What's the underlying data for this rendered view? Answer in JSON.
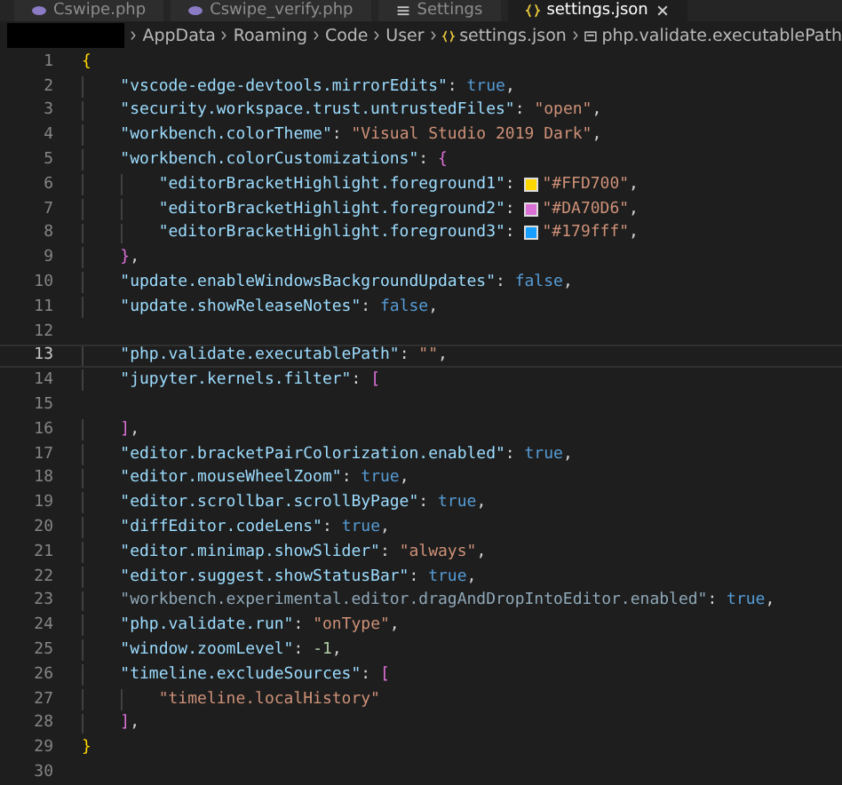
{
  "tabs": [
    {
      "label": "Cswipe.php",
      "kind": "php",
      "selected": false
    },
    {
      "label": "Cswipe_verify.php",
      "kind": "php",
      "selected": false
    },
    {
      "label": "Settings",
      "kind": "settings",
      "selected": false
    },
    {
      "label": "settings.json",
      "kind": "json",
      "selected": true
    }
  ],
  "breadcrumb": [
    {
      "label": "AppData",
      "kind": "folder"
    },
    {
      "label": "Roaming",
      "kind": "folder"
    },
    {
      "label": "Code",
      "kind": "folder"
    },
    {
      "label": "User",
      "kind": "folder"
    },
    {
      "label": "settings.json",
      "kind": "json"
    },
    {
      "label": "php.validate.executablePath",
      "kind": "property"
    }
  ],
  "lines": [
    {
      "number": "1",
      "active": false,
      "tokens": [
        {
          "kind": "bracket1",
          "text": "{"
        }
      ]
    },
    {
      "number": "2",
      "active": false,
      "tokens": [
        {
          "kind": "key",
          "text": "    \"vscode-edge-devtools.mirrorEdits\""
        },
        {
          "kind": "punct",
          "text": ": "
        },
        {
          "kind": "bool",
          "text": "true"
        },
        {
          "kind": "punct",
          "text": ","
        }
      ]
    },
    {
      "number": "3",
      "active": false,
      "tokens": [
        {
          "kind": "key",
          "text": "    \"security.workspace.trust.untrustedFiles\""
        },
        {
          "kind": "punct",
          "text": ": "
        },
        {
          "kind": "string",
          "text": "\"open\""
        },
        {
          "kind": "punct",
          "text": ","
        }
      ]
    },
    {
      "number": "4",
      "active": false,
      "tokens": [
        {
          "kind": "key",
          "text": "    \"workbench.colorTheme\""
        },
        {
          "kind": "punct",
          "text": ": "
        },
        {
          "kind": "string",
          "text": "\"Visual Studio 2019 Dark\""
        },
        {
          "kind": "punct",
          "text": ","
        }
      ]
    },
    {
      "number": "5",
      "active": false,
      "tokens": [
        {
          "kind": "key",
          "text": "    \"workbench.colorCustomizations\""
        },
        {
          "kind": "punct",
          "text": ": "
        },
        {
          "kind": "bracket2",
          "text": "{"
        }
      ]
    },
    {
      "number": "6",
      "active": false,
      "tokens": [
        {
          "kind": "key",
          "text": "        \"editorBracketHighlight.foreground1\""
        },
        {
          "kind": "punct",
          "text": ": "
        },
        {
          "kind": "swatch",
          "color": "#ffd700"
        },
        {
          "kind": "string",
          "text": "\"#FFD700\""
        },
        {
          "kind": "punct",
          "text": ","
        }
      ]
    },
    {
      "number": "7",
      "active": false,
      "tokens": [
        {
          "kind": "key",
          "text": "        \"editorBracketHighlight.foreground2\""
        },
        {
          "kind": "punct",
          "text": ": "
        },
        {
          "kind": "swatch",
          "color": "#da70d6"
        },
        {
          "kind": "string",
          "text": "\"#DA70D6\""
        },
        {
          "kind": "punct",
          "text": ","
        }
      ]
    },
    {
      "number": "8",
      "active": false,
      "tokens": [
        {
          "kind": "key",
          "text": "        \"editorBracketHighlight.foreground3\""
        },
        {
          "kind": "punct",
          "text": ": "
        },
        {
          "kind": "swatch",
          "color": "#179fff"
        },
        {
          "kind": "string",
          "text": "\"#179fff\""
        },
        {
          "kind": "punct",
          "text": ","
        }
      ]
    },
    {
      "number": "9",
      "active": false,
      "tokens": [
        {
          "kind": "bracket2",
          "text": "    }"
        },
        {
          "kind": "punct",
          "text": ","
        }
      ]
    },
    {
      "number": "10",
      "active": false,
      "tokens": [
        {
          "kind": "key",
          "text": "    \"update.enableWindowsBackgroundUpdates\""
        },
        {
          "kind": "punct",
          "text": ": "
        },
        {
          "kind": "bool",
          "text": "false"
        },
        {
          "kind": "punct",
          "text": ","
        }
      ]
    },
    {
      "number": "11",
      "active": false,
      "tokens": [
        {
          "kind": "key",
          "text": "    \"update.showReleaseNotes\""
        },
        {
          "kind": "punct",
          "text": ": "
        },
        {
          "kind": "bool",
          "text": "false"
        },
        {
          "kind": "punct",
          "text": ","
        }
      ]
    },
    {
      "number": "12",
      "active": false
    },
    {
      "number": "13",
      "active": true,
      "tokens": [
        {
          "kind": "key",
          "text": "    \"php.validate.executablePath\""
        },
        {
          "kind": "punct",
          "text": ": "
        },
        {
          "kind": "string",
          "text": "\"\""
        },
        {
          "kind": "punct",
          "text": ","
        }
      ]
    },
    {
      "number": "14",
      "active": false,
      "tokens": [
        {
          "kind": "key",
          "text": "    \"jupyter.kernels.filter\""
        },
        {
          "kind": "punct",
          "text": ": "
        },
        {
          "kind": "bracket2",
          "text": "["
        }
      ]
    },
    {
      "number": "15",
      "active": false
    },
    {
      "number": "16",
      "active": false,
      "tokens": [
        {
          "kind": "bracket2",
          "text": "    ]"
        },
        {
          "kind": "punct",
          "text": ","
        }
      ]
    },
    {
      "number": "17",
      "active": false,
      "tokens": [
        {
          "kind": "key",
          "text": "    \"editor.bracketPairColorization.enabled\""
        },
        {
          "kind": "punct",
          "text": ": "
        },
        {
          "kind": "bool",
          "text": "true"
        },
        {
          "kind": "punct",
          "text": ","
        }
      ]
    },
    {
      "number": "18",
      "active": false,
      "tokens": [
        {
          "kind": "key",
          "text": "    \"editor.mouseWheelZoom\""
        },
        {
          "kind": "punct",
          "text": ": "
        },
        {
          "kind": "bool",
          "text": "true"
        },
        {
          "kind": "punct",
          "text": ","
        }
      ]
    },
    {
      "number": "19",
      "active": false,
      "tokens": [
        {
          "kind": "key",
          "text": "    \"editor.scrollbar.scrollByPage\""
        },
        {
          "kind": "punct",
          "text": ": "
        },
        {
          "kind": "bool",
          "text": "true"
        },
        {
          "kind": "punct",
          "text": ","
        }
      ]
    },
    {
      "number": "20",
      "active": false,
      "tokens": [
        {
          "kind": "key",
          "text": "    \"diffEditor.codeLens\""
        },
        {
          "kind": "punct",
          "text": ": "
        },
        {
          "kind": "bool",
          "text": "true"
        },
        {
          "kind": "punct",
          "text": ","
        }
      ]
    },
    {
      "number": "21",
      "active": false,
      "tokens": [
        {
          "kind": "key",
          "text": "    \"editor.minimap.showSlider\""
        },
        {
          "kind": "punct",
          "text": ": "
        },
        {
          "kind": "string",
          "text": "\"always\""
        },
        {
          "kind": "punct",
          "text": ","
        }
      ]
    },
    {
      "number": "22",
      "active": false,
      "tokens": [
        {
          "kind": "key",
          "text": "    \"editor.suggest.showStatusBar\""
        },
        {
          "kind": "punct",
          "text": ": "
        },
        {
          "kind": "bool",
          "text": "true"
        },
        {
          "kind": "punct",
          "text": ","
        }
      ]
    },
    {
      "number": "23",
      "active": false,
      "tokens": [
        {
          "kind": "key_dim",
          "text": "    \"workbench.experimental.editor.dragAndDropIntoEditor.enabled\""
        },
        {
          "kind": "punct",
          "text": ": "
        },
        {
          "kind": "bool",
          "text": "true"
        },
        {
          "kind": "punct",
          "text": ","
        }
      ]
    },
    {
      "number": "24",
      "active": false,
      "tokens": [
        {
          "kind": "key",
          "text": "    \"php.validate.run\""
        },
        {
          "kind": "punct",
          "text": ": "
        },
        {
          "kind": "string",
          "text": "\"onType\""
        },
        {
          "kind": "punct",
          "text": ","
        }
      ]
    },
    {
      "number": "25",
      "active": false,
      "tokens": [
        {
          "kind": "key",
          "text": "    \"window.zoomLevel\""
        },
        {
          "kind": "punct",
          "text": ": "
        },
        {
          "kind": "number",
          "text": "-1"
        },
        {
          "kind": "punct",
          "text": ","
        }
      ]
    },
    {
      "number": "26",
      "active": false,
      "tokens": [
        {
          "kind": "key",
          "text": "    \"timeline.excludeSources\""
        },
        {
          "kind": "punct",
          "text": ": "
        },
        {
          "kind": "bracket2",
          "text": "["
        }
      ]
    },
    {
      "number": "27",
      "active": false,
      "tokens": [
        {
          "kind": "string",
          "text": "        \"timeline.localHistory\""
        }
      ]
    },
    {
      "number": "28",
      "active": false,
      "tokens": [
        {
          "kind": "bracket2",
          "text": "    ]"
        },
        {
          "kind": "punct",
          "text": ","
        }
      ]
    },
    {
      "number": "29",
      "active": false,
      "tokens": [
        {
          "kind": "bracket1",
          "text": "}"
        }
      ]
    },
    {
      "number": "30",
      "active": false
    }
  ]
}
